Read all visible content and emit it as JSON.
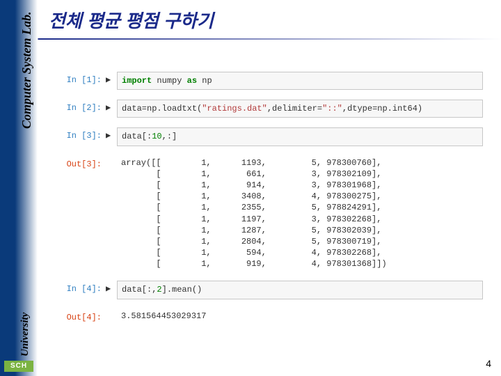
{
  "sidebar": {
    "top_label": "Computer System Lab.",
    "bottom_label": "University",
    "logo": "SCH"
  },
  "title": "전체 평균 평점 구하기",
  "page_number": "4",
  "cells": [
    {
      "prompt": "In [1]:",
      "type": "in",
      "code_html": "<span class=\"kw\">import</span> numpy <span class=\"kw\">as</span> np"
    },
    {
      "prompt": "In [2]:",
      "type": "in",
      "code_html": "data=np.loadtxt(<span class=\"str\">\"ratings.dat\"</span>,delimiter=<span class=\"str\">\"::\"</span>,dtype=np.int64)"
    },
    {
      "prompt": "In [3]:",
      "type": "in",
      "code_html": "data[:<span class=\"builtin\">10</span>,:]"
    },
    {
      "prompt": "Out[3]:",
      "type": "out",
      "output": "array([[        1,      1193,         5, 978300760],\n       [        1,       661,         3, 978302109],\n       [        1,       914,         3, 978301968],\n       [        1,      3408,         4, 978300275],\n       [        1,      2355,         5, 978824291],\n       [        1,      1197,         3, 978302268],\n       [        1,      1287,         5, 978302039],\n       [        1,      2804,         5, 978300719],\n       [        1,       594,         4, 978302268],\n       [        1,       919,         4, 978301368]])"
    },
    {
      "prompt": "In [4]:",
      "type": "in",
      "code_html": "data[:,<span class=\"builtin\">2</span>].mean()"
    },
    {
      "prompt": "Out[4]:",
      "type": "out",
      "output": "3.581564453029317"
    }
  ]
}
